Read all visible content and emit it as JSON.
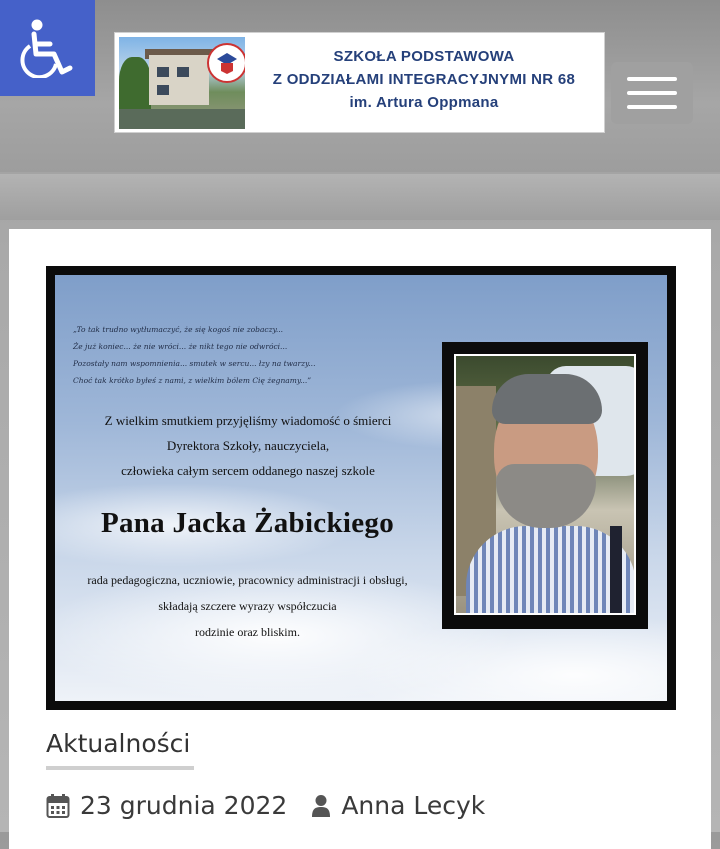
{
  "accessibility": {
    "icon": "wheelchair-icon"
  },
  "banner": {
    "line1": "SZKOŁA PODSTAWOWA",
    "line2": "Z ODDZIAŁAMI INTEGRACYJNYMI NR 68",
    "line3": "im. Artura Oppmana"
  },
  "menu": {
    "icon": "hamburger-menu-icon"
  },
  "notice": {
    "quote": [
      "„To tak trudno wytłumaczyć, że się kogoś nie zobaczy...",
      "Że już koniec... że nie wróci... że nikt tego nie odwróci...",
      "Pozostały nam wspomnienia... smutek w sercu... łzy na twarzy...",
      "Choć tak krótko byłeś z nami, z wielkim bólem Cię żegnamy...”"
    ],
    "lead": [
      "Z wielkim smutkiem przyjęliśmy wiadomość o śmierci",
      "Dyrektora Szkoły, nauczyciela,",
      "człowieka całym sercem oddanego naszej szkole"
    ],
    "name": "Pana Jacka Żabickiego",
    "footer": [
      "rada pedagogiczna, uczniowie, pracownicy administracji i obsługi,",
      "składają szczere wyrazy współczucia",
      "rodzinie oraz bliskim."
    ]
  },
  "article": {
    "category": "Aktualności",
    "date": "23 grudnia 2022",
    "author": "Anna Lecyk"
  }
}
